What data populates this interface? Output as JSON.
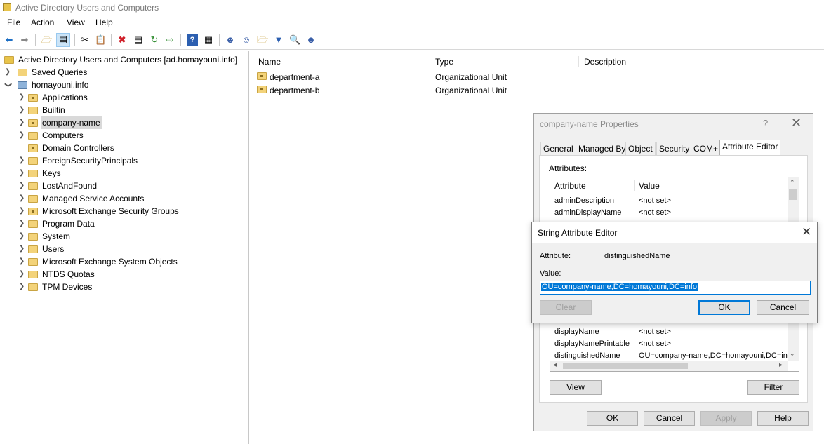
{
  "window": {
    "title": "Active Directory Users and Computers"
  },
  "menu": {
    "items": [
      "File",
      "Action",
      "View",
      "Help"
    ]
  },
  "toolbar": {
    "icons": [
      "back-icon",
      "forward-icon",
      "up-folder-icon",
      "show-console-tree-icon",
      "cut-icon",
      "copy-icon",
      "delete-icon",
      "properties-icon",
      "refresh-icon",
      "export-list-icon",
      "help-icon",
      "show-action-pane-icon",
      "new-user-icon",
      "new-group-icon",
      "new-ou-icon",
      "filter-icon",
      "find-icon",
      "add-to-group-icon"
    ]
  },
  "tree": {
    "root": "Active Directory Users and Computers [ad.homayouni.info]",
    "saved_queries": "Saved Queries",
    "domain": "homayouni.info",
    "children": [
      "Applications",
      "Builtin",
      "company-name",
      "Computers",
      "Domain Controllers",
      "ForeignSecurityPrincipals",
      "Keys",
      "LostAndFound",
      "Managed Service Accounts",
      "Microsoft Exchange Security Groups",
      "Program Data",
      "System",
      "Users",
      "Microsoft Exchange System Objects",
      "NTDS Quotas",
      "TPM Devices"
    ],
    "selected": "company-name"
  },
  "list": {
    "columns": [
      "Name",
      "Type",
      "Description"
    ],
    "rows": [
      {
        "name": "department-a",
        "type": "Organizational Unit"
      },
      {
        "name": "department-b",
        "type": "Organizational Unit"
      }
    ]
  },
  "properties": {
    "title": "company-name Properties",
    "help": "?",
    "tabs": [
      "General",
      "Managed By",
      "Object",
      "Security",
      "COM+",
      "Attribute Editor"
    ],
    "active_tab": "Attribute Editor",
    "attributes_label": "Attributes:",
    "headers": {
      "attribute": "Attribute",
      "value": "Value"
    },
    "rows_top": [
      {
        "attr": "adminDescription",
        "value": "<not set>"
      },
      {
        "attr": "adminDisplayName",
        "value": "<not set>"
      }
    ],
    "rows_bottom": [
      {
        "attr": "displayName",
        "value": "<not set>"
      },
      {
        "attr": "displayNamePrintable",
        "value": "<not set>"
      },
      {
        "attr": "distinguishedName",
        "value": "OU=company-name,DC=homayouni,DC=info"
      }
    ],
    "buttons": {
      "view": "View",
      "filter": "Filter",
      "ok": "OK",
      "cancel": "Cancel",
      "apply": "Apply",
      "help": "Help"
    }
  },
  "string_editor": {
    "title": "String Attribute Editor",
    "attribute_label": "Attribute:",
    "attribute_value": "distinguishedName",
    "value_label": "Value:",
    "value": "OU=company-name,DC=homayouni,DC=info",
    "buttons": {
      "clear": "Clear",
      "ok": "OK",
      "cancel": "Cancel"
    }
  }
}
